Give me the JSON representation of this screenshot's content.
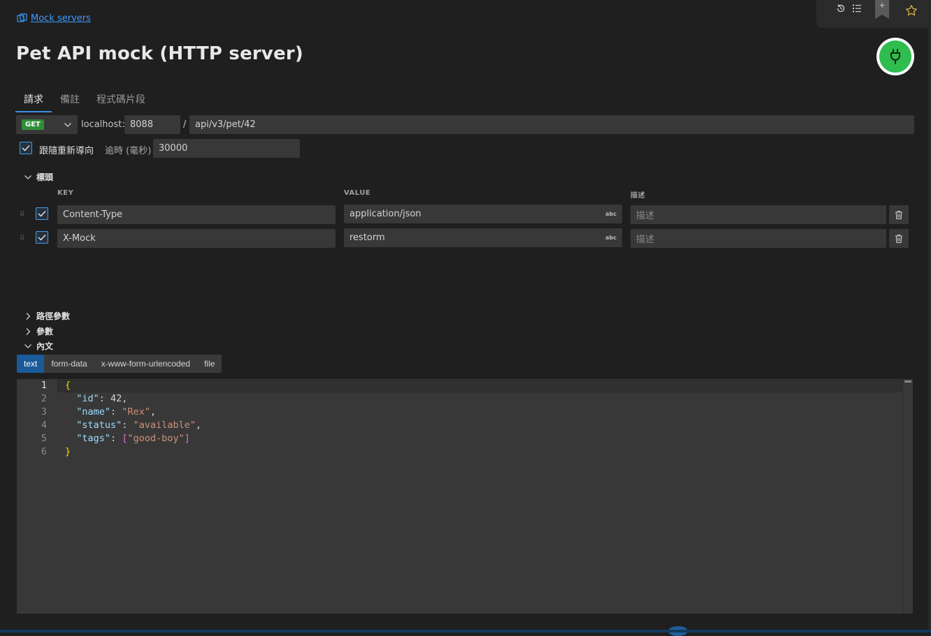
{
  "breadcrumb": {
    "label": "Mock servers",
    "icon": "mock-server-icon"
  },
  "toolbar": {
    "icons": [
      "history-icon",
      "list-icon",
      "bookmark-add-icon",
      "star-icon"
    ],
    "bookmark_plus": "+"
  },
  "title": "Pet API mock (HTTP server)",
  "connect": {
    "icon": "plug-icon",
    "color": "#2ebd4e"
  },
  "tabs": [
    {
      "label": "請求",
      "active": true
    },
    {
      "label": "備註",
      "active": false
    },
    {
      "label": "程式碼片段",
      "active": false
    }
  ],
  "request": {
    "method": "GET",
    "method_color": "#2f8e39",
    "host": "localhost:",
    "port": "8088",
    "separator": "/",
    "path": "api/v3/pet/42",
    "follow_redirects": {
      "label": "跟隨重新導向",
      "checked": true
    },
    "timeout": {
      "label": "逾時 (毫秒)",
      "value": "30000"
    }
  },
  "headers": {
    "title": "標頭",
    "expanded": true,
    "columns": {
      "key": "KEY",
      "value": "VALUE",
      "description": "描述"
    },
    "rows": [
      {
        "checked": true,
        "key": "Content-Type",
        "value": "application/json",
        "type_badge": "abc",
        "description_placeholder": "描述"
      },
      {
        "checked": true,
        "key": "X-Mock",
        "value": "restorm",
        "type_badge": "abc",
        "description_placeholder": "描述"
      }
    ]
  },
  "sections": {
    "path_params": {
      "title": "路徑參數",
      "expanded": false
    },
    "params": {
      "title": "參數",
      "expanded": false
    },
    "body": {
      "title": "內文",
      "expanded": true
    }
  },
  "body_tabs": [
    {
      "label": "text",
      "active": true
    },
    {
      "label": "form-data",
      "active": false
    },
    {
      "label": "x-www-form-urlencoded",
      "active": false
    },
    {
      "label": "file",
      "active": false
    }
  ],
  "editor": {
    "line_numbers": [
      "1",
      "2",
      "3",
      "4",
      "5",
      "6"
    ],
    "current_line": 1,
    "lines": [
      "{",
      "  \"id\": 42,",
      "  \"name\": \"Rex\",",
      "  \"status\": \"available\",",
      "  \"tags\": [\"good-boy\"]",
      "}"
    ]
  }
}
